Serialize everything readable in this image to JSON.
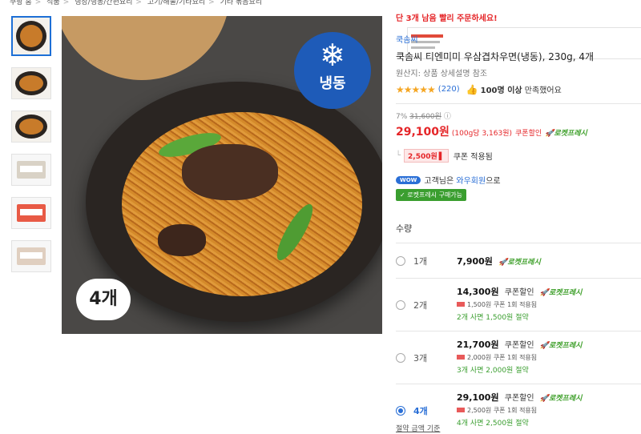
{
  "breadcrumb": [
    "쿠팡 홈",
    "식품",
    "냉장/냉동/간편요리",
    "고기/해물/기타요리",
    "기타 볶음요리"
  ],
  "image_badges": {
    "frozen_label": "냉동",
    "count_label": "4개"
  },
  "product": {
    "urgent_notice": "단 3개 남음 빨리 주문하세요!",
    "brand": "쿡솜씨",
    "title": "쿡솜씨 티엔미미 우삼겹차우면(냉동), 230g, 4개",
    "origin": "원산지: 상품 상세설명 참조",
    "stars": "★★★★★",
    "rating_value": 4.5,
    "review_count": "(220)",
    "buyers_strong": "100명 이상",
    "buyers_text": "만족했어요",
    "discount_pct": "7%",
    "original_price": "31,600원",
    "info_icon": "ⓘ",
    "price": "29,100원",
    "unit_price": "(100g당 3,163원)",
    "coupon_text": "쿠폰할인",
    "rocket_fresh": "로켓프레시",
    "coupon_amount": "2,500원",
    "coupon_applied": "쿠폰 적용됨",
    "wow_label": "WOW",
    "wow_text_pre": "고객님은",
    "wow_text_hl": "와우회원",
    "wow_text_post": "으로",
    "fresh_badge": "✓ 로켓프레시 구매가능"
  },
  "quantity": {
    "label": "수량",
    "options": [
      {
        "qty": "1개",
        "price": "7,900원",
        "coupon": "",
        "rocket": "로켓프레시",
        "detail_amount": "",
        "detail_text": "",
        "save": "",
        "selected": false
      },
      {
        "qty": "2개",
        "price": "14,300원",
        "coupon": "쿠폰할인",
        "rocket": "로켓프레시",
        "detail_amount": "1,500원",
        "detail_text": "쿠폰 1회 적용됨",
        "save": "2개 사면 1,500원 절약",
        "selected": false
      },
      {
        "qty": "3개",
        "price": "21,700원",
        "coupon": "쿠폰할인",
        "rocket": "로켓프레시",
        "detail_amount": "2,000원",
        "detail_text": "쿠폰 1회 적용됨",
        "save": "3개 사면 2,000원 절약",
        "selected": false
      },
      {
        "qty": "4개",
        "price": "29,100원",
        "coupon": "쿠폰할인",
        "rocket": "로켓프레시",
        "detail_amount": "2,500원",
        "detail_text": "쿠폰 1회 적용됨",
        "save": "4개 사면 2,500원 절약",
        "selected": true
      }
    ]
  },
  "footer_link": "절약 금액 기준",
  "colors": {
    "accent_blue": "#2a6fd6",
    "price_red": "#e52528",
    "fresh_green": "#3a9e2f",
    "star": "#f5a623"
  }
}
